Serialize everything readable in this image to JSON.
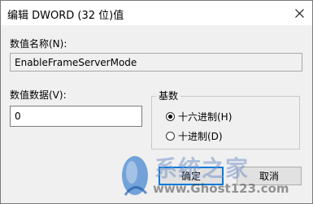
{
  "dialog": {
    "title": "编辑 DWORD (32 位)值",
    "value_name_label": "数值名称(N):",
    "value_name": "EnableFrameServerMode",
    "value_data_label": "数值数据(V):",
    "value_data": "0",
    "base_group_title": "基数",
    "base_options": [
      {
        "label": "十六进制(H)",
        "checked": true
      },
      {
        "label": "十进制(D)",
        "checked": false
      }
    ],
    "ok_label": "确定",
    "cancel_label": "取消"
  },
  "watermark": {
    "brand": "系统之家",
    "url": "www.Ghost123.com"
  },
  "colors": {
    "accent": "#0078d7",
    "dialog_bg": "#f0f0f0"
  }
}
